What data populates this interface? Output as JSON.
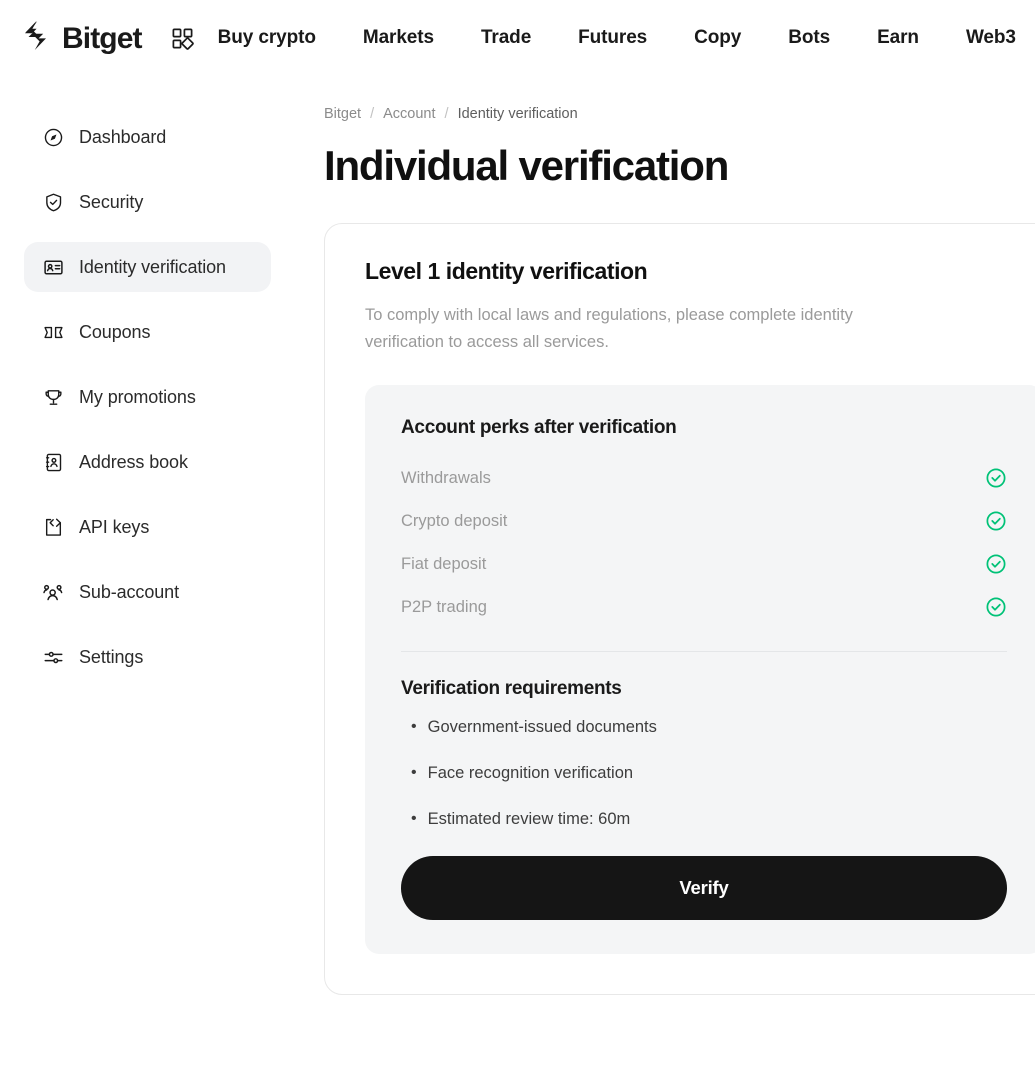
{
  "topnav": {
    "brand": {
      "name": "Bitget",
      "logo_icon": "bitget-chevron-logo"
    },
    "grid_icon": "grid-apps-icon",
    "items": [
      {
        "label": "Buy crypto"
      },
      {
        "label": "Markets"
      },
      {
        "label": "Trade"
      },
      {
        "label": "Futures"
      },
      {
        "label": "Copy"
      },
      {
        "label": "Bots"
      },
      {
        "label": "Earn"
      },
      {
        "label": "Web3"
      }
    ]
  },
  "sidebar": {
    "items": [
      {
        "label": "Dashboard",
        "icon": "compass-icon",
        "active": false
      },
      {
        "label": "Security",
        "icon": "shield-check-icon",
        "active": false
      },
      {
        "label": "Identity verification",
        "icon": "id-card-icon",
        "active": true
      },
      {
        "label": "Coupons",
        "icon": "ticket-icon",
        "active": false
      },
      {
        "label": "My promotions",
        "icon": "trophy-icon",
        "active": false
      },
      {
        "label": "Address book",
        "icon": "address-book-icon",
        "active": false
      },
      {
        "label": "API keys",
        "icon": "code-brackets-icon",
        "active": false
      },
      {
        "label": "Sub-account",
        "icon": "users-group-icon",
        "active": false
      },
      {
        "label": "Settings",
        "icon": "sliders-icon",
        "active": false
      }
    ]
  },
  "breadcrumb": {
    "root": "Bitget",
    "sep": "/",
    "middle": "Account",
    "current": "Identity verification"
  },
  "page": {
    "title": "Individual verification"
  },
  "card": {
    "title": "Level 1 identity verification",
    "description": "To comply with local laws and regulations, please complete identity verification to access all services.",
    "perks_heading": "Account perks after verification",
    "perks": [
      {
        "label": "Withdrawals",
        "status": "included",
        "icon": "check-circle-icon"
      },
      {
        "label": "Crypto deposit",
        "status": "included",
        "icon": "check-circle-icon"
      },
      {
        "label": "Fiat deposit",
        "status": "included",
        "icon": "check-circle-icon"
      },
      {
        "label": "P2P trading",
        "status": "included",
        "icon": "check-circle-icon"
      }
    ],
    "requirements_heading": "Verification requirements",
    "requirements": [
      {
        "bullet": "•",
        "text": "Government-issued documents"
      },
      {
        "bullet": "•",
        "text": "Face recognition verification"
      },
      {
        "bullet": "•",
        "text": "Estimated review time: 60m"
      }
    ],
    "verify_label": "Verify"
  },
  "colors": {
    "accent_green": "#00c277",
    "button_dark": "#151515",
    "panel_gray": "#f4f5f6",
    "card_border": "#e8e8e8",
    "muted_text": "#9a9a9a",
    "sidebar_active": "#f2f3f5"
  }
}
